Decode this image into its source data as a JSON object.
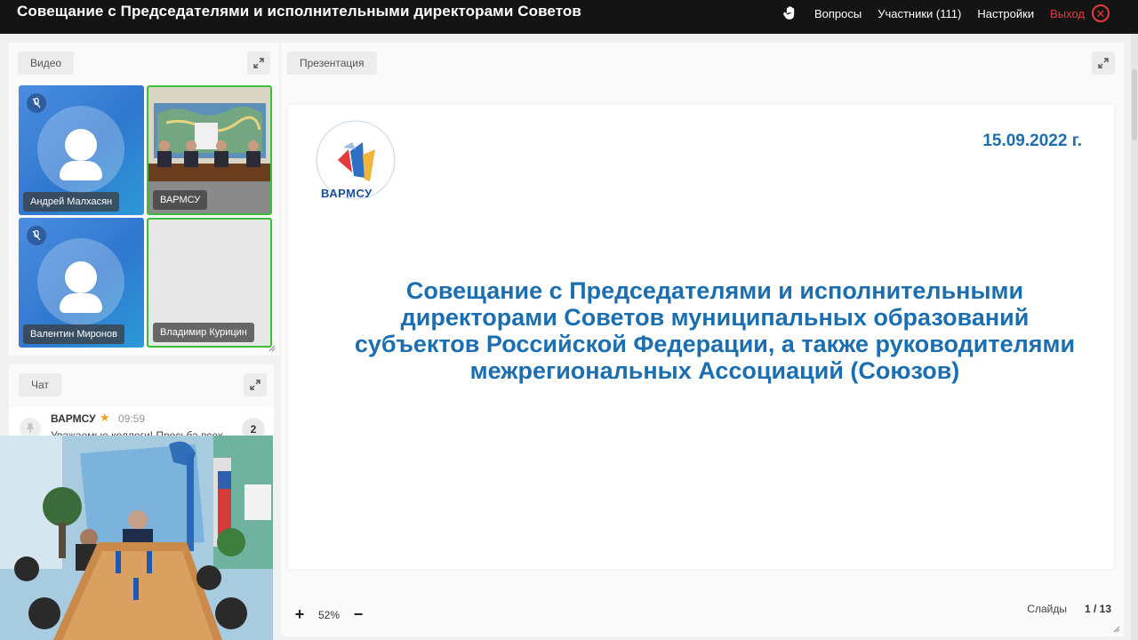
{
  "header": {
    "title": "Совещание с Председателями и исполнительными директорами Советов",
    "questions_label": "Вопросы",
    "participants_label": "Участники (111)",
    "settings_label": "Настройки",
    "exit_label": "Выход"
  },
  "video": {
    "label": "Видео",
    "tiles": [
      {
        "name": "Андрей Малхасян",
        "muted": true
      },
      {
        "name": "ВАРМСУ",
        "muted": false
      },
      {
        "name": "Валентин Миронов",
        "muted": true
      },
      {
        "name": "Владимир Курицин",
        "muted": false
      }
    ]
  },
  "chat": {
    "label": "Чат",
    "message": {
      "author": "ВАРМСУ",
      "time": "09:59",
      "text": "Уважаемые коллеги! Просьба всех",
      "count": "2"
    }
  },
  "presentation": {
    "label": "Презентация",
    "slide": {
      "date": "15.09.2022 г.",
      "logo_text": "ВАРМСУ",
      "title": "Совещание с Председателями и исполнительными директорами Советов муниципальных образований субъектов Российской Федерации, а также руководителями межрегиональных Ассоциаций (Союзов)"
    },
    "zoom": "52%",
    "slides_label": "Слайды",
    "slides_counter": "1 / 13"
  },
  "colors": {
    "topbar": "#141414",
    "accent_blue": "#1b6fb0",
    "exit_red": "#e53b3b",
    "active_border": "#3bbf3b"
  }
}
